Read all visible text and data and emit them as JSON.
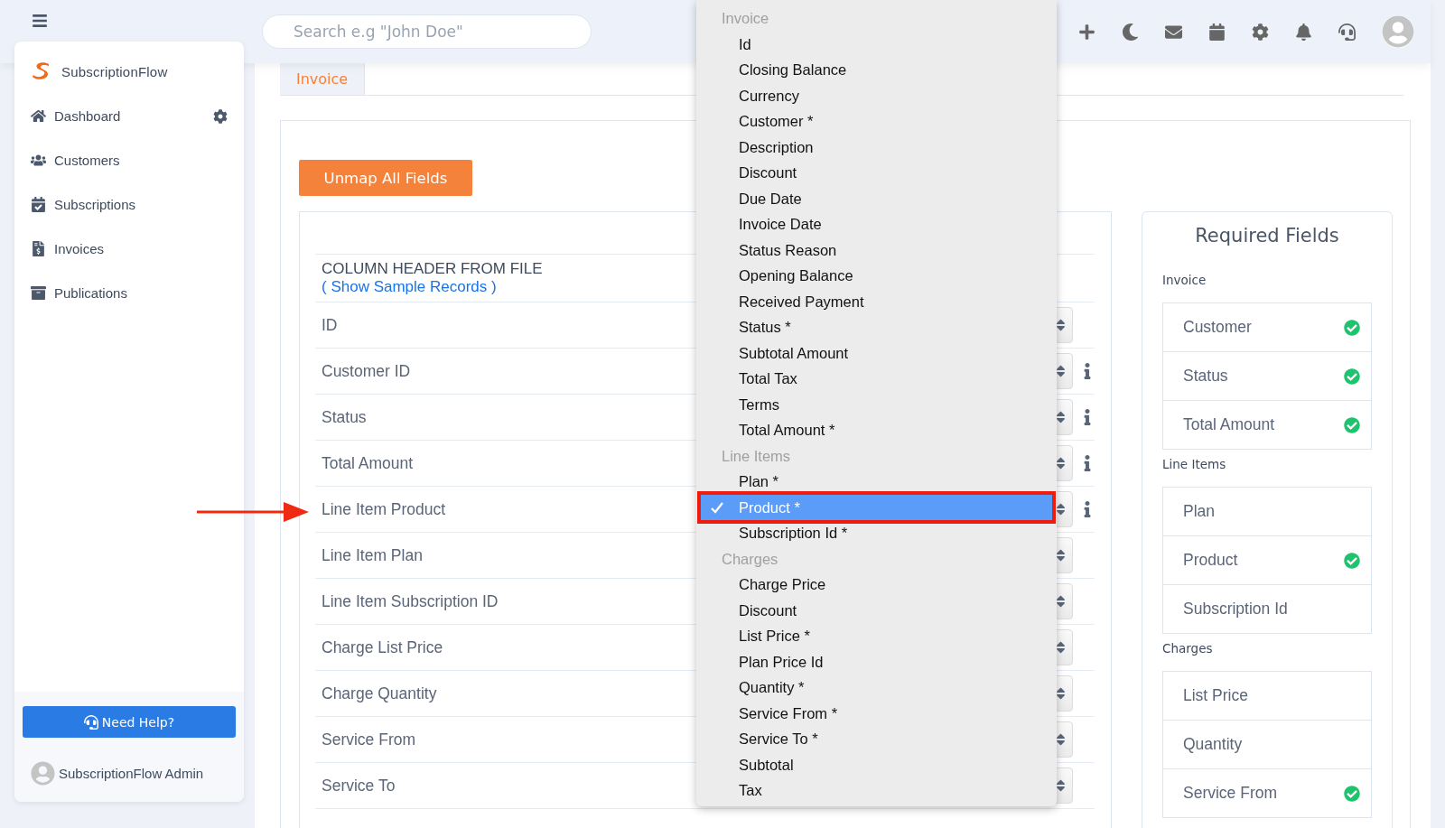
{
  "sidebar": {
    "brand": "SubscriptionFlow",
    "items": [
      {
        "kind": "dashboard",
        "label": "Dashboard",
        "settings": true
      },
      {
        "kind": "customers",
        "label": "Customers",
        "settings": false
      },
      {
        "kind": "subscriptions",
        "label": "Subscriptions",
        "settings": false
      },
      {
        "kind": "invoices",
        "label": "Invoices",
        "settings": false
      },
      {
        "kind": "publications",
        "label": "Publications",
        "settings": false
      }
    ],
    "help_button": "Need Help?",
    "user": "SubscriptionFlow Admin"
  },
  "search": {
    "placeholder": "Search e.g \"John Doe\""
  },
  "tabs": [
    {
      "label": "Invoice",
      "selected": true
    }
  ],
  "unmap_button": "Unmap All Fields",
  "mapping": {
    "header": "COLUMN HEADER FROM FILE ",
    "header_link": "( Show Sample Records )",
    "rows": [
      {
        "label": "ID",
        "info": false
      },
      {
        "label": "Customer ID",
        "info": true
      },
      {
        "label": "Status",
        "info": true
      },
      {
        "label": "Total Amount",
        "info": true
      },
      {
        "label": "Line Item Product",
        "info": true
      },
      {
        "label": "Line Item Plan",
        "info": false
      },
      {
        "label": "Line Item Subscription ID",
        "info": false
      },
      {
        "label": "Charge List Price",
        "info": false
      },
      {
        "label": "Charge Quantity",
        "info": false
      },
      {
        "label": "Service From",
        "info": false
      },
      {
        "label": "Service To",
        "info": false
      }
    ]
  },
  "required": {
    "title": "Required Fields",
    "sections": [
      {
        "label": "Invoice",
        "fields": [
          {
            "label": "Customer",
            "mapped": true
          },
          {
            "label": "Status",
            "mapped": true
          },
          {
            "label": "Total Amount",
            "mapped": true
          }
        ]
      },
      {
        "label": "Line Items",
        "fields": [
          {
            "label": "Plan",
            "mapped": false
          },
          {
            "label": "Product",
            "mapped": true
          },
          {
            "label": "Subscription Id",
            "mapped": false
          }
        ]
      },
      {
        "label": "Charges",
        "fields": [
          {
            "label": "List Price",
            "mapped": false
          },
          {
            "label": "Quantity",
            "mapped": false
          },
          {
            "label": "Service From",
            "mapped": true
          }
        ]
      }
    ]
  },
  "dropdown": {
    "groups": [
      {
        "label": "Invoice",
        "items": [
          {
            "label": "Id",
            "selected": false
          },
          {
            "label": "Closing Balance",
            "selected": false
          },
          {
            "label": "Currency",
            "selected": false
          },
          {
            "label": "Customer *",
            "selected": false
          },
          {
            "label": "Description",
            "selected": false
          },
          {
            "label": "Discount",
            "selected": false
          },
          {
            "label": "Due Date",
            "selected": false
          },
          {
            "label": "Invoice Date",
            "selected": false
          },
          {
            "label": "Status Reason",
            "selected": false
          },
          {
            "label": "Opening Balance",
            "selected": false
          },
          {
            "label": "Received Payment",
            "selected": false
          },
          {
            "label": "Status *",
            "selected": false
          },
          {
            "label": "Subtotal Amount",
            "selected": false
          },
          {
            "label": "Total Tax",
            "selected": false
          },
          {
            "label": "Terms",
            "selected": false
          },
          {
            "label": "Total Amount *",
            "selected": false
          }
        ]
      },
      {
        "label": "Line Items",
        "items": [
          {
            "label": "Plan *",
            "selected": false
          },
          {
            "label": "Product *",
            "selected": true
          },
          {
            "label": "Subscription Id *",
            "selected": false
          }
        ]
      },
      {
        "label": "Charges",
        "items": [
          {
            "label": "Charge Price",
            "selected": false
          },
          {
            "label": "Discount",
            "selected": false
          },
          {
            "label": "List Price *",
            "selected": false
          },
          {
            "label": "Plan Price Id",
            "selected": false
          },
          {
            "label": "Quantity *",
            "selected": false
          },
          {
            "label": "Service From *",
            "selected": false
          },
          {
            "label": "Service To *",
            "selected": false
          },
          {
            "label": "Subtotal",
            "selected": false
          },
          {
            "label": "Tax",
            "selected": false
          }
        ]
      }
    ]
  }
}
